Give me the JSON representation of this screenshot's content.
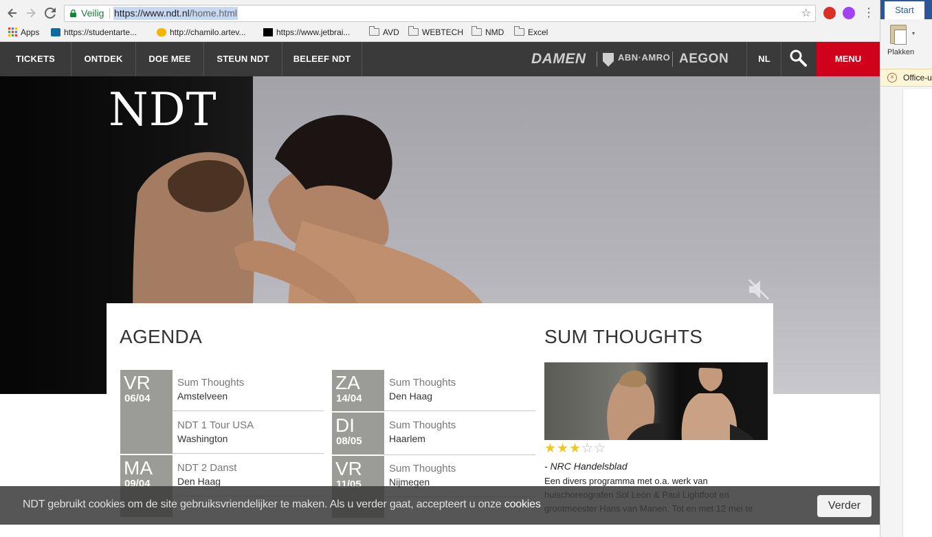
{
  "browser": {
    "secure_label": "Veilig",
    "url_main": "https://www.ndt.nl",
    "url_path": "/home.html",
    "bookmarks": [
      {
        "label": "Apps",
        "icon": "apps-grid-icon"
      },
      {
        "label": "https://studentarte...",
        "icon": "sharepoint-icon"
      },
      {
        "label": "http://chamilo.artev...",
        "icon": "chamilo-icon"
      },
      {
        "label": "https://www.jetbrai...",
        "icon": "jetbrains-icon"
      },
      {
        "label": "AVD",
        "icon": "folder-icon"
      },
      {
        "label": "WEBTECH",
        "icon": "folder-icon"
      },
      {
        "label": "NMD",
        "icon": "folder-icon"
      },
      {
        "label": "Excel",
        "icon": "folder-icon"
      }
    ]
  },
  "office": {
    "tab": "Start",
    "paste_label": "Plakken",
    "notice": "Office-u"
  },
  "nav": {
    "items": [
      "TICKETS",
      "ONTDEK",
      "DOE MEE",
      "STEUN NDT",
      "BELEEF NDT"
    ],
    "sponsors": [
      "DAMEN",
      "ABN·AMRO",
      "AEGON"
    ],
    "language": "NL",
    "menu": "MENU"
  },
  "hero": {
    "logo": "NDT"
  },
  "agenda": {
    "title": "AGENDA",
    "left_days": [
      {
        "day": "VR",
        "date": "06/04",
        "events": [
          {
            "title": "Sum Thoughts",
            "place": "Amstelveen"
          },
          {
            "title": "NDT 1 Tour USA",
            "place": "Washington"
          }
        ]
      },
      {
        "day": "MA",
        "date": "09/04",
        "events": [
          {
            "title": "NDT 2 Danst",
            "place": "Den Haag"
          }
        ]
      }
    ],
    "right_days": [
      {
        "day": "ZA",
        "date": "14/04",
        "events": [
          {
            "title": "Sum Thoughts",
            "place": "Den Haag"
          }
        ]
      },
      {
        "day": "DI",
        "date": "08/05",
        "events": [
          {
            "title": "Sum Thoughts",
            "place": "Haarlem"
          }
        ]
      },
      {
        "day": "VR",
        "date": "11/05",
        "events": [
          {
            "title": "Sum Thoughts",
            "place": "Nijmegen"
          }
        ]
      }
    ]
  },
  "feature": {
    "title": "SUM THOUGHTS",
    "rating": 3,
    "rating_max": 5,
    "source": "- NRC Handelsblad",
    "description": "Een divers programma met o.a. werk van huischoreografen Sol León & Paul Lightfoot en grootmeester Hans van Manen. Tot en met 12 mei te"
  },
  "cookie": {
    "message": "NDT gebruikt cookies om de site gebruiksvriendelijker te maken. Als u verder gaat, accepteert u onze",
    "link": "cookies",
    "button": "Verder"
  },
  "colors": {
    "nav_bg": "#3a3a3a",
    "menu_red": "#d0021b",
    "day_box": "#9b9b97",
    "star_gold": "#f5c518"
  }
}
